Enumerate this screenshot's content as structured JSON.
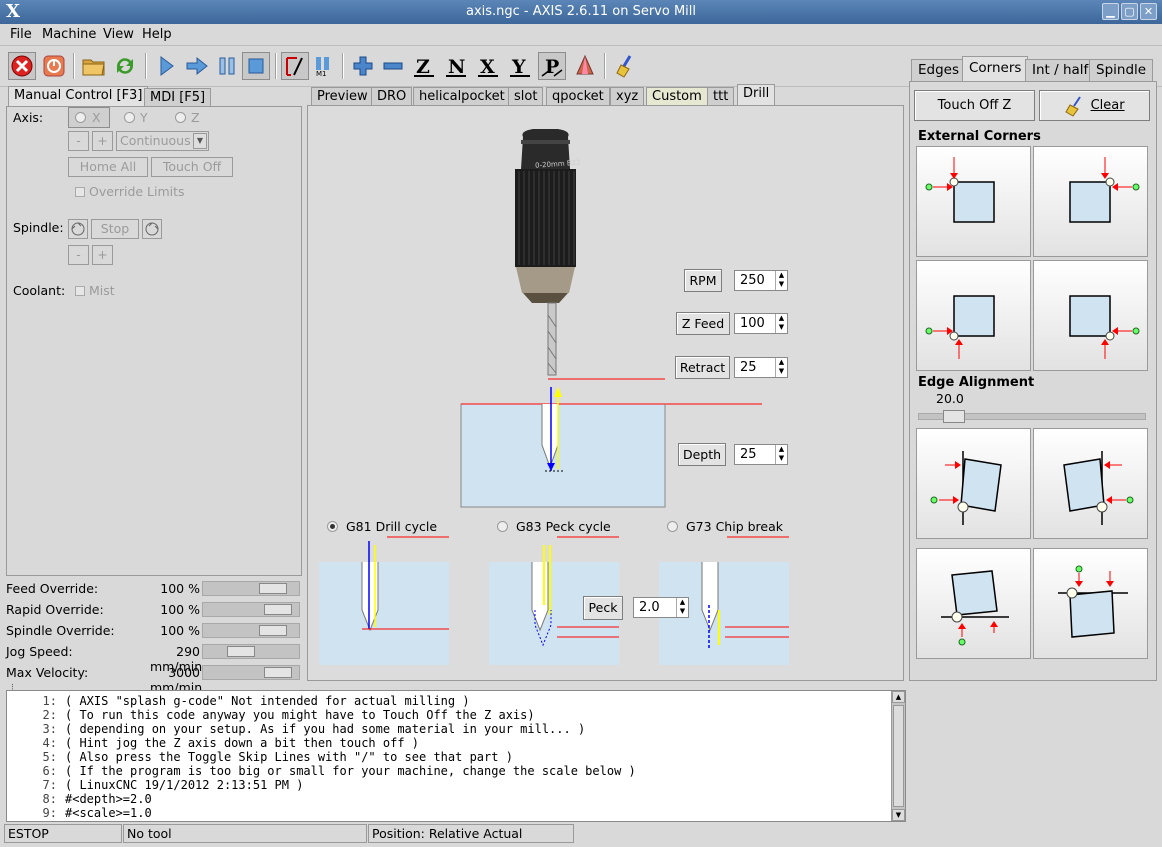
{
  "window": {
    "title": "axis.ngc - AXIS 2.6.11 on Servo  Mill",
    "logo": "X"
  },
  "menu": [
    "File",
    "Machine",
    "View",
    "Help"
  ],
  "toolbar": {
    "icons": [
      "estop-icon",
      "power-icon",
      "open-folder-icon",
      "reload-icon",
      "run-icon",
      "step-icon",
      "pause-icon",
      "stop-icon",
      "skip-lines-icon",
      "optional-stop-icon",
      "zoom-in-icon",
      "zoom-out-icon",
      "view-z-icon",
      "view-z-rotated-icon",
      "view-x-icon",
      "view-y-icon",
      "view-p-icon",
      "rotate-icon",
      "clear-plot-icon"
    ]
  },
  "left": {
    "tabs": [
      "Manual Control [F3]",
      "MDI [F5]"
    ],
    "axis_label": "Axis:",
    "axes": [
      "X",
      "Y",
      "Z"
    ],
    "jog_minus": "-",
    "jog_plus": "+",
    "jog_mode": "Continuous",
    "home_all": "Home All",
    "touch_off": "Touch Off",
    "override_limits": "Override Limits",
    "spindle_label": "Spindle:",
    "spindle_stop": "Stop",
    "coolant_label": "Coolant:",
    "mist": "Mist"
  },
  "overrides": [
    {
      "label": "Feed Override:",
      "value": "100 %",
      "fraction": 0.82
    },
    {
      "label": "Rapid Override:",
      "value": "100 %",
      "fraction": 0.9
    },
    {
      "label": "Spindle Override:",
      "value": "100 %",
      "fraction": 0.82
    },
    {
      "label": "Jog Speed:",
      "value": "290 mm/min",
      "fraction": 0.35
    },
    {
      "label": "Max Velocity:",
      "value": "3000 mm/min",
      "fraction": 0.9
    }
  ],
  "center": {
    "tabs": [
      "Preview",
      "DRO",
      "helicalpocket",
      "slot",
      "qpocket",
      "xyz",
      "Custom",
      "ttt",
      "Drill"
    ],
    "active_tab": "Drill",
    "chuck_text": "0-20mm B22",
    "params": [
      {
        "label": "RPM",
        "value": "250"
      },
      {
        "label": "Z Feed",
        "value": "100"
      },
      {
        "label": "Retract",
        "value": "25"
      },
      {
        "label": "Depth",
        "value": "25"
      }
    ],
    "cycles": [
      {
        "label": "G81 Drill cycle",
        "selected": true
      },
      {
        "label": "G83 Peck cycle",
        "selected": false
      },
      {
        "label": "G73 Chip break",
        "selected": false
      }
    ],
    "peck_label": "Peck",
    "peck_value": "2.0"
  },
  "right": {
    "tabs": [
      "Edges",
      "Corners",
      "Int / half",
      "Spindle"
    ],
    "active_tab": "Corners",
    "touch_off_z": "Touch Off Z",
    "clear": "Clear",
    "external_corners": "External Corners",
    "edge_alignment": "Edge Alignment",
    "edge_value": "20.0",
    "edge_fraction": 0.12
  },
  "code_lines": [
    {
      "n": "1:",
      "text": "( AXIS \"splash g-code\" Not intended for actual milling )"
    },
    {
      "n": "2:",
      "text": "( To run this code anyway you might have to Touch Off the Z axis)"
    },
    {
      "n": "3:",
      "text": "( depending on your setup. As if you had some material in your mill... )"
    },
    {
      "n": "4:",
      "text": "( Hint jog the Z axis down a bit then touch off )"
    },
    {
      "n": "5:",
      "text": "( Also press the Toggle Skip Lines with \"/\" to see that part )"
    },
    {
      "n": "6:",
      "text": "( If the program is too big or small for your machine, change the scale below )"
    },
    {
      "n": "7:",
      "text": "( LinuxCNC 19/1/2012 2:13:51 PM )"
    },
    {
      "n": "8:",
      "text": "#<depth>=2.0"
    },
    {
      "n": "9:",
      "text": "#<scale>=1.0"
    }
  ],
  "status": {
    "estop": "ESTOP",
    "tool": "No tool",
    "position": "Position: Relative Actual"
  },
  "colors": {
    "title_bar": "#4a76a8",
    "material": "#cfe3f1",
    "red": "#ff0000",
    "yellow": "#ffff00",
    "blue": "#0000ff"
  }
}
